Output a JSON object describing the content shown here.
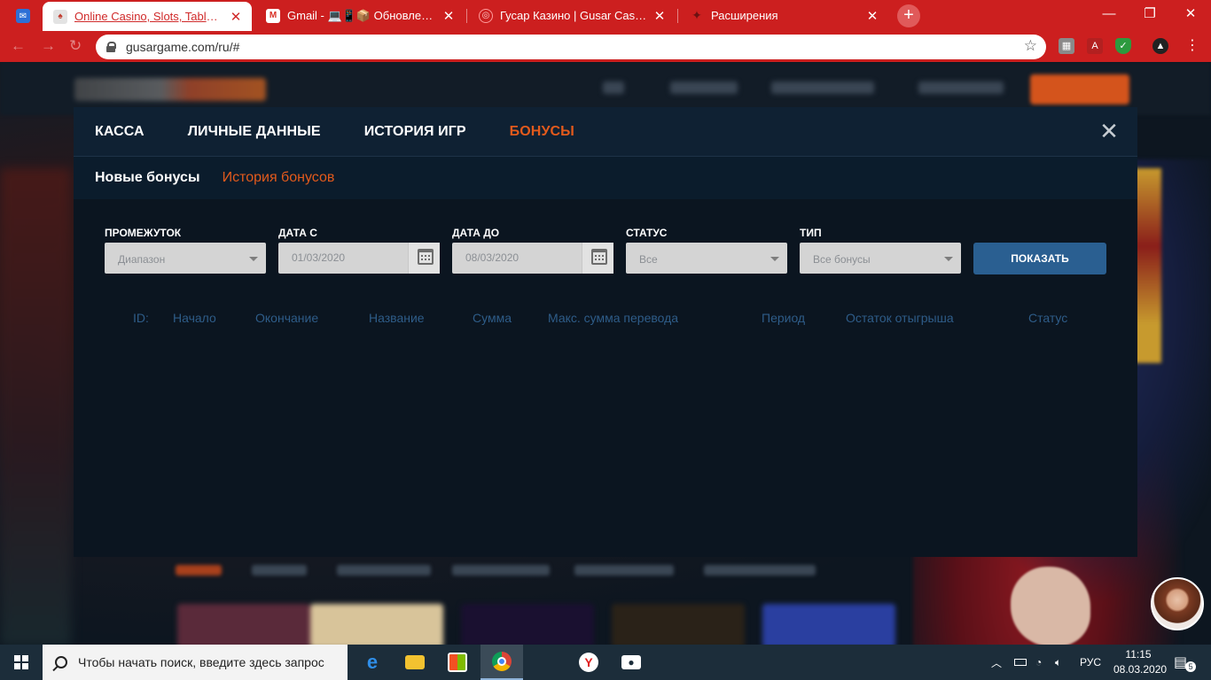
{
  "browser": {
    "tabs": [
      {
        "title": "Online Casino, Slots, Table Games",
        "active": true
      },
      {
        "title": "Gmail - 💻📱📦 Обновления на",
        "active": false
      },
      {
        "title": "Гусар Казино | Gusar Casino. Об",
        "active": false
      },
      {
        "title": "Расширения",
        "active": false
      }
    ],
    "url": "gusargame.com/ru/#"
  },
  "modal": {
    "tabs": [
      {
        "label": "КАССА",
        "active": false
      },
      {
        "label": "ЛИЧНЫЕ ДАННЫЕ",
        "active": false
      },
      {
        "label": "ИСТОРИЯ ИГР",
        "active": false
      },
      {
        "label": "БОНУСЫ",
        "active": true
      }
    ],
    "close_icon": "close-icon",
    "subtabs": [
      {
        "label": "Новые бонусы",
        "active": false
      },
      {
        "label": "История бонусов",
        "active": true
      }
    ],
    "filters": {
      "period": {
        "label": "ПРОМЕЖУТОК",
        "value": "Диапазон"
      },
      "date_from": {
        "label": "ДАТА С",
        "value": "01/03/2020"
      },
      "date_to": {
        "label": "ДАТА ДО",
        "value": "08/03/2020"
      },
      "status": {
        "label": "СТАТУС",
        "value": "Все"
      },
      "type": {
        "label": "ТИП",
        "value": "Все бонусы"
      },
      "show_button": "ПОКАЗАТЬ"
    },
    "table": {
      "columns": [
        "ID:",
        "Начало",
        "Окончание",
        "Название",
        "Сумма",
        "Макс. сумма перевода",
        "Период",
        "Остаток отыгрыша",
        "Статус"
      ]
    }
  },
  "taskbar": {
    "search_placeholder": "Чтобы начать поиск, введите здесь запрос",
    "language": "РУС",
    "time": "11:15",
    "date": "08.03.2020",
    "notifications": "5"
  },
  "colors": {
    "browser_red": "#cc1f1f",
    "accent_orange": "#e35a1c",
    "button_blue": "#2a5f91",
    "column_header_blue": "#2e5c88"
  }
}
